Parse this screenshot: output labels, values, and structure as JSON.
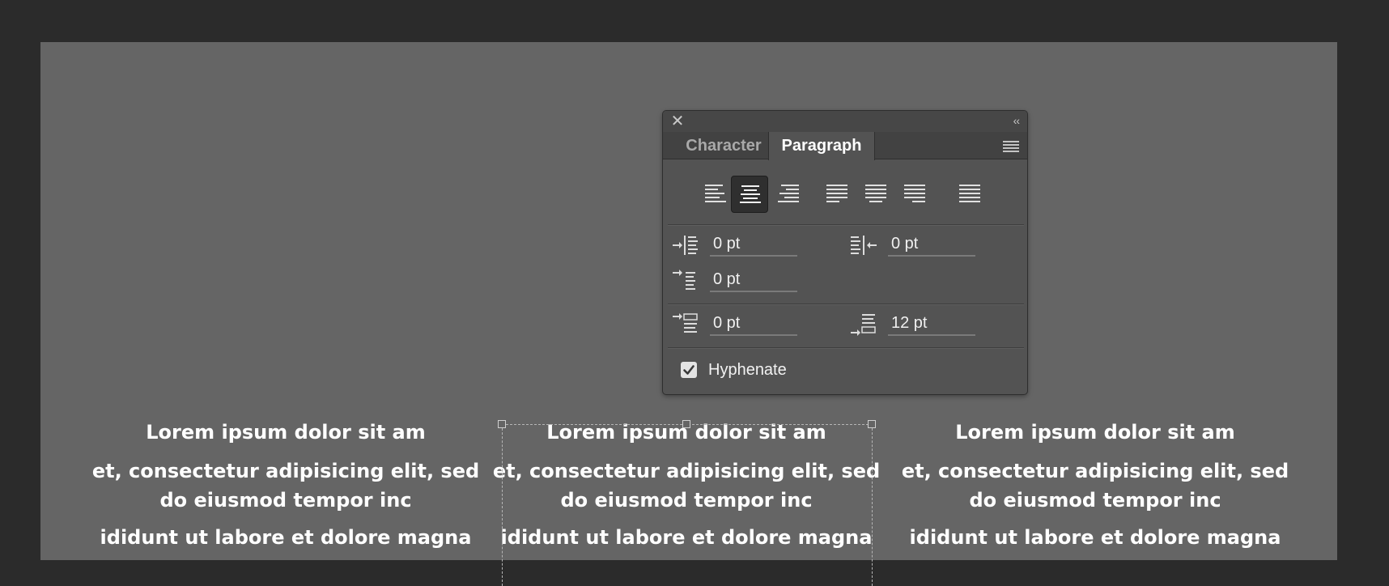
{
  "document": {
    "columns": [
      {
        "line1": "Lorem ipsum dolor sit am",
        "line2": "et, consectetur adipisicing elit, sed",
        "line3": "do eiusmod tempor inc",
        "line4": "ididunt ut labore et dolore magna"
      },
      {
        "line1": "Lorem ipsum dolor sit am",
        "line2": "et, consectetur adipisicing elit, sed",
        "line3": "do eiusmod tempor inc",
        "line4": "ididunt ut labore et dolore magna"
      },
      {
        "line1": "Lorem ipsum dolor sit am",
        "line2": "et, consectetur adipisicing elit, sed",
        "line3": "do eiusmod tempor inc",
        "line4": "ididunt ut labore et dolore magna"
      }
    ]
  },
  "panel": {
    "close_glyph": "✕",
    "collapse_glyph": "‹‹",
    "tabs": {
      "character": "Character",
      "paragraph": "Paragraph"
    },
    "alignment": {
      "options": [
        "align-left",
        "align-center",
        "align-right",
        "justify-last-left",
        "justify-last-center",
        "justify-last-right",
        "justify-all"
      ],
      "selected": "align-center"
    },
    "indent_left": "0 pt",
    "indent_right": "0 pt",
    "indent_first_line": "0 pt",
    "space_before": "0 pt",
    "space_after": "12 pt",
    "hyphenate_label": "Hyphenate",
    "hyphenate_checked": true
  },
  "colors": {
    "app_background": "#2b2b2b",
    "canvas": "#656565",
    "panel": "#535353",
    "text": "#ffffff"
  }
}
